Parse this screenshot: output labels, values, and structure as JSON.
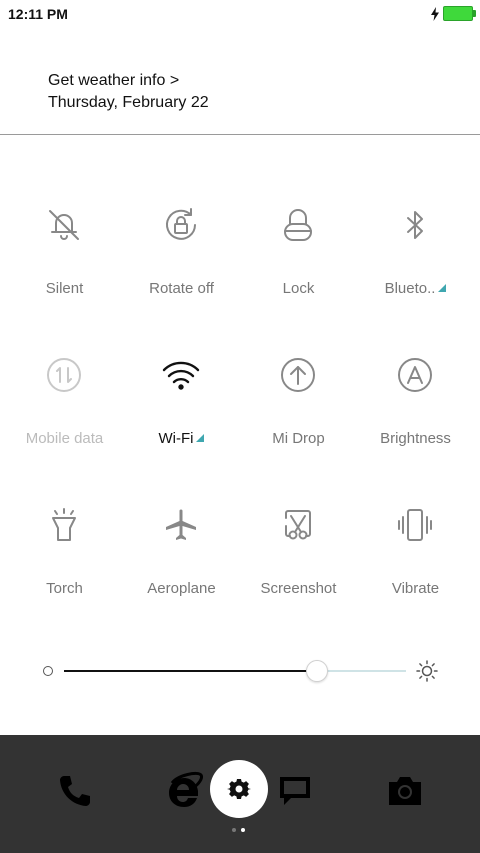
{
  "status": {
    "time": "12:11 PM",
    "battery_color": "#3fd93b"
  },
  "weather": {
    "link": "Get weather info >",
    "date": "Thursday, February 22"
  },
  "toggles": [
    {
      "label": "Silent",
      "icon": "bell-off-icon",
      "state": "off"
    },
    {
      "label": "Rotate off",
      "icon": "rotation-lock-icon",
      "state": "off"
    },
    {
      "label": "Lock",
      "icon": "lock-icon",
      "state": "off"
    },
    {
      "label": "Blueto..",
      "icon": "bluetooth-icon",
      "state": "off",
      "has_menu": true
    },
    {
      "label": "Mobile data",
      "icon": "mobile-data-icon",
      "state": "disabled"
    },
    {
      "label": "Wi-Fi",
      "icon": "wifi-icon",
      "state": "on",
      "has_menu": true
    },
    {
      "label": "Mi Drop",
      "icon": "upload-arrow-icon",
      "state": "off"
    },
    {
      "label": "Brightness",
      "icon": "auto-brightness-icon",
      "state": "off"
    },
    {
      "label": "Torch",
      "icon": "flashlight-icon",
      "state": "off"
    },
    {
      "label": "Aeroplane",
      "icon": "airplane-icon",
      "state": "off"
    },
    {
      "label": "Screenshot",
      "icon": "scissors-icon",
      "state": "off"
    },
    {
      "label": "Vibrate",
      "icon": "vibrate-icon",
      "state": "off"
    }
  ],
  "brightness": {
    "level": 0.73,
    "accent": "#3fa7b0"
  },
  "dock": {
    "apps": [
      "phone-icon",
      "browser-icon",
      "settings-icon",
      "messages-icon",
      "camera-icon"
    ],
    "page_count": 2,
    "current_page": 2
  }
}
